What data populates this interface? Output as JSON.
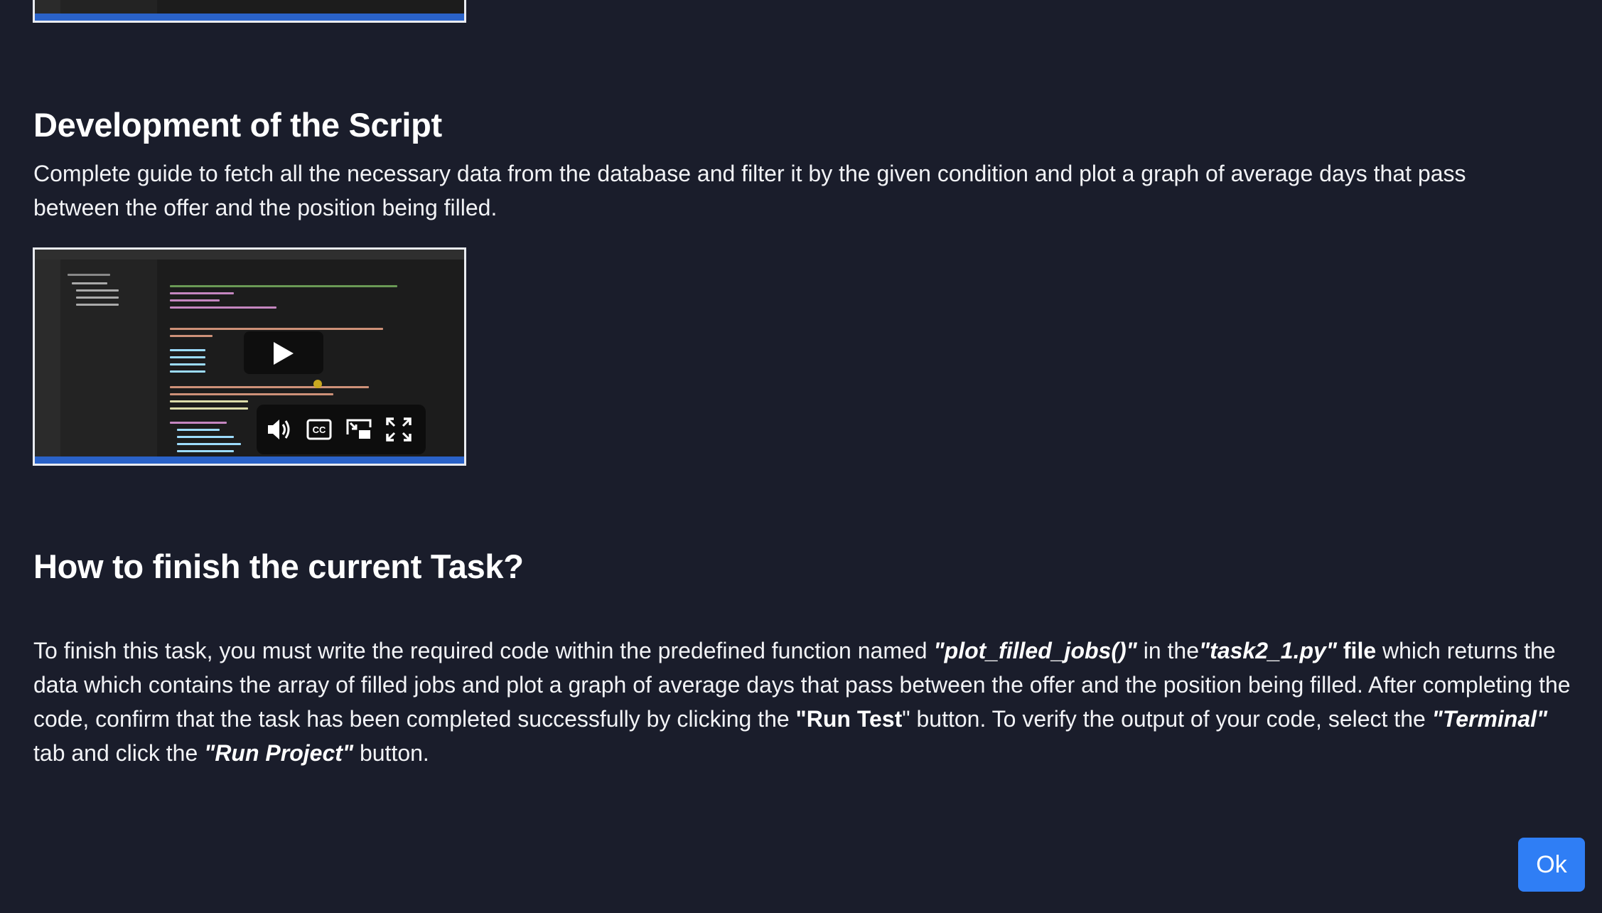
{
  "video1": {
    "label": "Video player (previous section)"
  },
  "section1": {
    "heading": "Development of the Script",
    "description": "Complete guide to fetch all the necessary data from the database and filter it by the given condition and plot a graph of average days that pass between the offer and the position being filled."
  },
  "video2": {
    "controls": [
      "play-icon",
      "volume-icon",
      "closed-captions-icon",
      "picture-in-picture-icon",
      "fullscreen-icon"
    ]
  },
  "section2": {
    "heading": "How to finish the current Task?",
    "p1": "To finish this task, you must write the required code within the predefined function named ",
    "fn_name": "\"plot_filled_jobs()\"",
    "p2": " in the",
    "file_name": "\"task2_1.py\"",
    "file_word": " file",
    "p3": " which returns the data which contains the array of filled jobs and plot a graph of average days that pass between the offer and the position being filled. After completing the code, confirm that the task has been completed successfully by clicking the ",
    "run_test": "\"Run Test",
    "p4": "\" button. To verify the output of your code, select the ",
    "terminal": "\"Terminal\"",
    "p5": " tab and click the ",
    "run_project": "\"Run Project\"",
    "p6": " button."
  },
  "ok_button": {
    "label": "Ok"
  },
  "colors": {
    "background": "#1a1d2b",
    "button": "#2f7ef5",
    "text": "#ffffff"
  }
}
